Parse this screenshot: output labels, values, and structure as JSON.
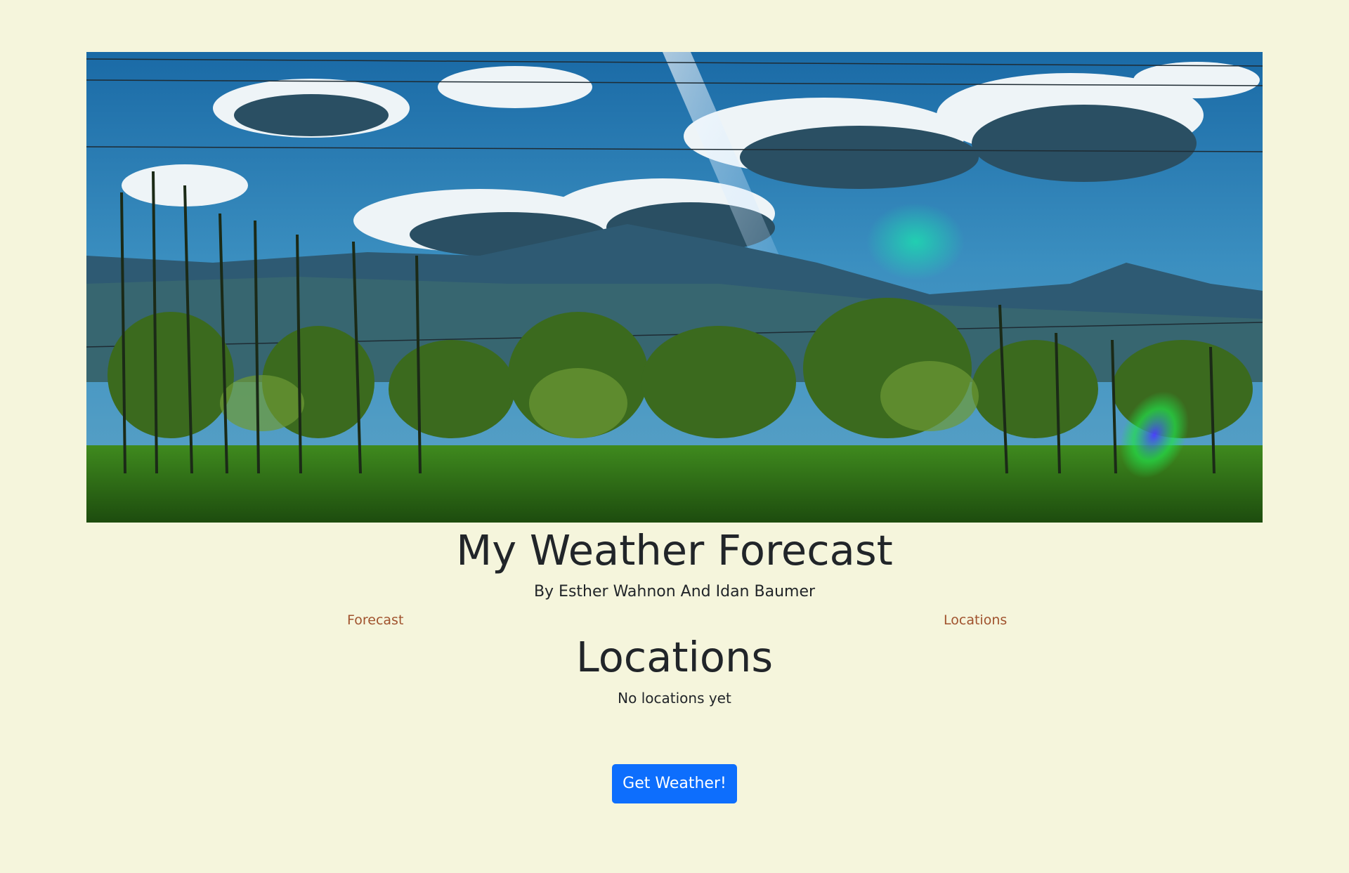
{
  "header": {
    "title": "My Weather Forecast",
    "subtitle": "By Esther Wahnon And Idan Baumer"
  },
  "nav": {
    "items": [
      {
        "label": "Forecast"
      },
      {
        "label": "Locations"
      }
    ]
  },
  "main": {
    "heading": "Locations",
    "empty_message": "No locations yet",
    "action_label": "Get Weather!"
  },
  "colors": {
    "background": "#f5f5dc",
    "link": "#a0522d",
    "button": "#0d6efd",
    "text": "#212529"
  }
}
